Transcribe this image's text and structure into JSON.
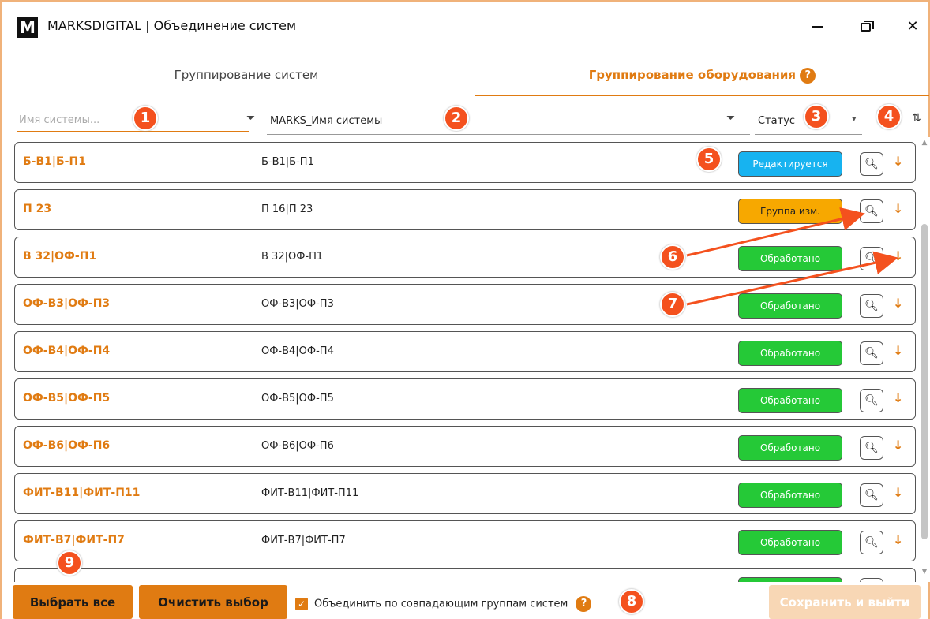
{
  "window": {
    "logo": "M",
    "title": "MARKSDIGITAL | Объединение систем"
  },
  "tabs": {
    "systems": "Группирование систем",
    "equipment": "Группирование оборудования"
  },
  "filters": {
    "name_placeholder": "Имя системы...",
    "marks_label": "MARKS_Имя системы",
    "status_label": "Статус"
  },
  "markers": [
    "1",
    "2",
    "3",
    "4",
    "5",
    "6",
    "7",
    "8",
    "9"
  ],
  "rows": [
    {
      "name": "Б-В1|Б-П1",
      "marks": "Б-В1|Б-П1",
      "status": "Редактируется",
      "kind": "editing"
    },
    {
      "name": "П 23",
      "marks": "П 16|П 23",
      "status": "Группа изм.",
      "kind": "group"
    },
    {
      "name": "В 32|ОФ-П1",
      "marks": "В 32|ОФ-П1",
      "status": "Обработано",
      "kind": "done"
    },
    {
      "name": "ОФ-В3|ОФ-П3",
      "marks": "ОФ-В3|ОФ-П3",
      "status": "Обработано",
      "kind": "done"
    },
    {
      "name": "ОФ-В4|ОФ-П4",
      "marks": "ОФ-В4|ОФ-П4",
      "status": "Обработано",
      "kind": "done"
    },
    {
      "name": "ОФ-В5|ОФ-П5",
      "marks": "ОФ-В5|ОФ-П5",
      "status": "Обработано",
      "kind": "done"
    },
    {
      "name": "ОФ-В6|ОФ-П6",
      "marks": "ОФ-В6|ОФ-П6",
      "status": "Обработано",
      "kind": "done"
    },
    {
      "name": "ФИТ-В11|ФИТ-П11",
      "marks": "ФИТ-В11|ФИТ-П11",
      "status": "Обработано",
      "kind": "done"
    },
    {
      "name": "ФИТ-В7|ФИТ-П7",
      "marks": "ФИТ-В7|ФИТ-П7",
      "status": "Обработано",
      "kind": "done"
    },
    {
      "name": "",
      "marks": "",
      "status": "",
      "kind": "done"
    }
  ],
  "footer": {
    "select_all": "Выбрать все",
    "clear_selection": "Очистить выбор",
    "merge_checkbox": "Объединить по совпадающим группам систем",
    "save_exit": "Сохранить и выйти"
  },
  "colors": {
    "accent": "#e07b12",
    "marker": "#f4511e",
    "editing": "#17b3f0",
    "group": "#f7a800",
    "done": "#25c937"
  },
  "icons": {
    "filter": "filter-icon",
    "search": "search-icon",
    "down": "arrow-down-icon",
    "sort": "sort-icon",
    "help": "help-icon"
  }
}
